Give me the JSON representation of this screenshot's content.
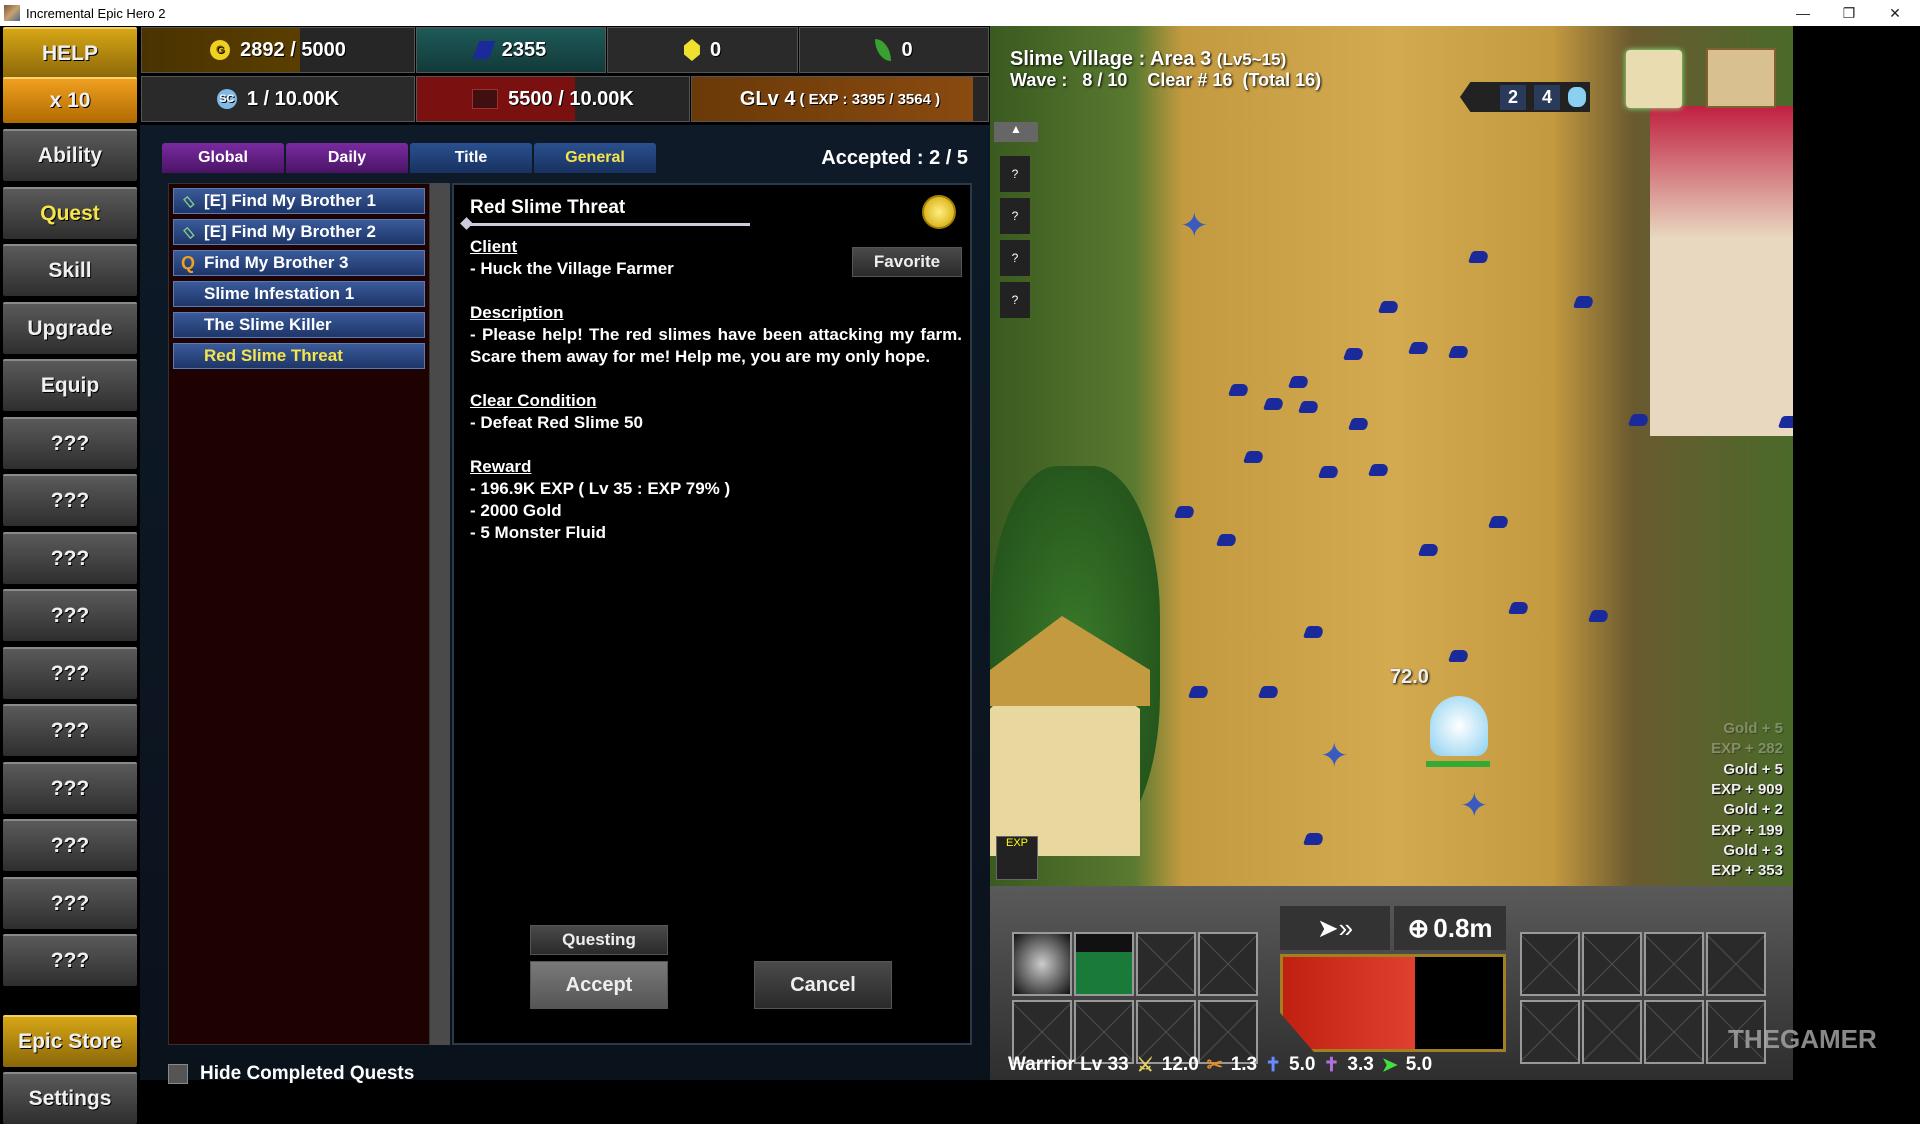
{
  "window": {
    "title": "Incremental Epic Hero 2",
    "controls": [
      "minimize",
      "restore",
      "close"
    ]
  },
  "sidebar": {
    "help": "HELP",
    "multiplier": "x 10",
    "items": [
      "Ability",
      "Quest",
      "Skill",
      "Upgrade",
      "Equip",
      "???",
      "???",
      "???",
      "???",
      "???",
      "???",
      "???",
      "???",
      "???",
      "???"
    ],
    "active": "Quest",
    "epic_store": "Epic Store",
    "settings": "Settings"
  },
  "resources": {
    "gold": {
      "icon": "gold-coin-icon",
      "value": "2892 / 5000"
    },
    "gems": {
      "icon": "blue-gem-icon",
      "value": "2355"
    },
    "yellow": {
      "icon": "yellow-crystal-icon",
      "value": "0"
    },
    "leaf": {
      "icon": "leaf-icon",
      "value": "0"
    },
    "sc": {
      "icon": "sc-coin-icon",
      "value": "1 / 10.00K"
    },
    "fluid": {
      "icon": "monster-icon",
      "value": "5500 / 10.00K"
    },
    "glv": {
      "label": "GLv 4",
      "exp": "( EXP : 3395 / 3564 )"
    }
  },
  "quest": {
    "tabs": [
      {
        "label": "Global"
      },
      {
        "label": "Daily"
      },
      {
        "label": "Title"
      },
      {
        "label": "General"
      }
    ],
    "selected_tab": "General",
    "accepted": "Accepted : 2 / 5",
    "list": [
      {
        "label": "[E] Find My Brother 1",
        "icon": "clear-stamp-icon"
      },
      {
        "label": "[E] Find My Brother 2",
        "icon": "clear-stamp-icon"
      },
      {
        "label": "Find My Brother 3",
        "icon": "quest-q-icon"
      },
      {
        "label": "Slime Infestation 1",
        "icon": ""
      },
      {
        "label": "The Slime Killer",
        "icon": ""
      },
      {
        "label": "Red Slime Threat",
        "icon": ""
      }
    ],
    "selected": "Red Slime Threat",
    "detail": {
      "title": "Red Slime Threat",
      "favorite": "Favorite",
      "client_h": "Client",
      "client": "- Huck the Village Farmer",
      "desc_h": "Description",
      "desc": "- Please help! The red slimes have been attacking my farm. Scare them away for me! Help me, you are my only hope.",
      "cond_h": "Clear Condition",
      "cond": "- Defeat Red Slime 50",
      "reward_h": "Reward",
      "rewards": [
        "- 196.9K EXP  ( Lv 35 : EXP 79% )",
        "- 2000 Gold",
        "- 5 Monster Fluid"
      ]
    },
    "questing": "Questing",
    "accept": "Accept",
    "cancel": "Cancel",
    "hide_completed": "Hide Completed Quests"
  },
  "game": {
    "area": "Slime Village : Area 3",
    "level_range": "(Lv5~15)",
    "wave": "Wave :   8 / 10    Clear # 16  (Total 16)",
    "speed_counts": [
      "2",
      "4"
    ],
    "damage_popup": "72.0",
    "side_buttons": [
      "?",
      "?",
      "?",
      "?"
    ],
    "loot": [
      "Gold + 5",
      "EXP + 282",
      "Gold + 5",
      "EXP + 909",
      "Gold + 2",
      "EXP + 199",
      "Gold + 3",
      "EXP + 353"
    ],
    "range": "0.8m",
    "hero": {
      "class": "Warrior Lv 33",
      "atk": "12.0",
      "spd": "1.3",
      "def": "5.0",
      "mdef": "3.3",
      "move": "5.0"
    },
    "watermark": "THEGAMER"
  },
  "colors": {
    "accent_yellow": "#f5e44a",
    "tab_purple": "#7a2aa0",
    "tab_blue": "#2a5090",
    "list_bg": "#1e0202"
  }
}
